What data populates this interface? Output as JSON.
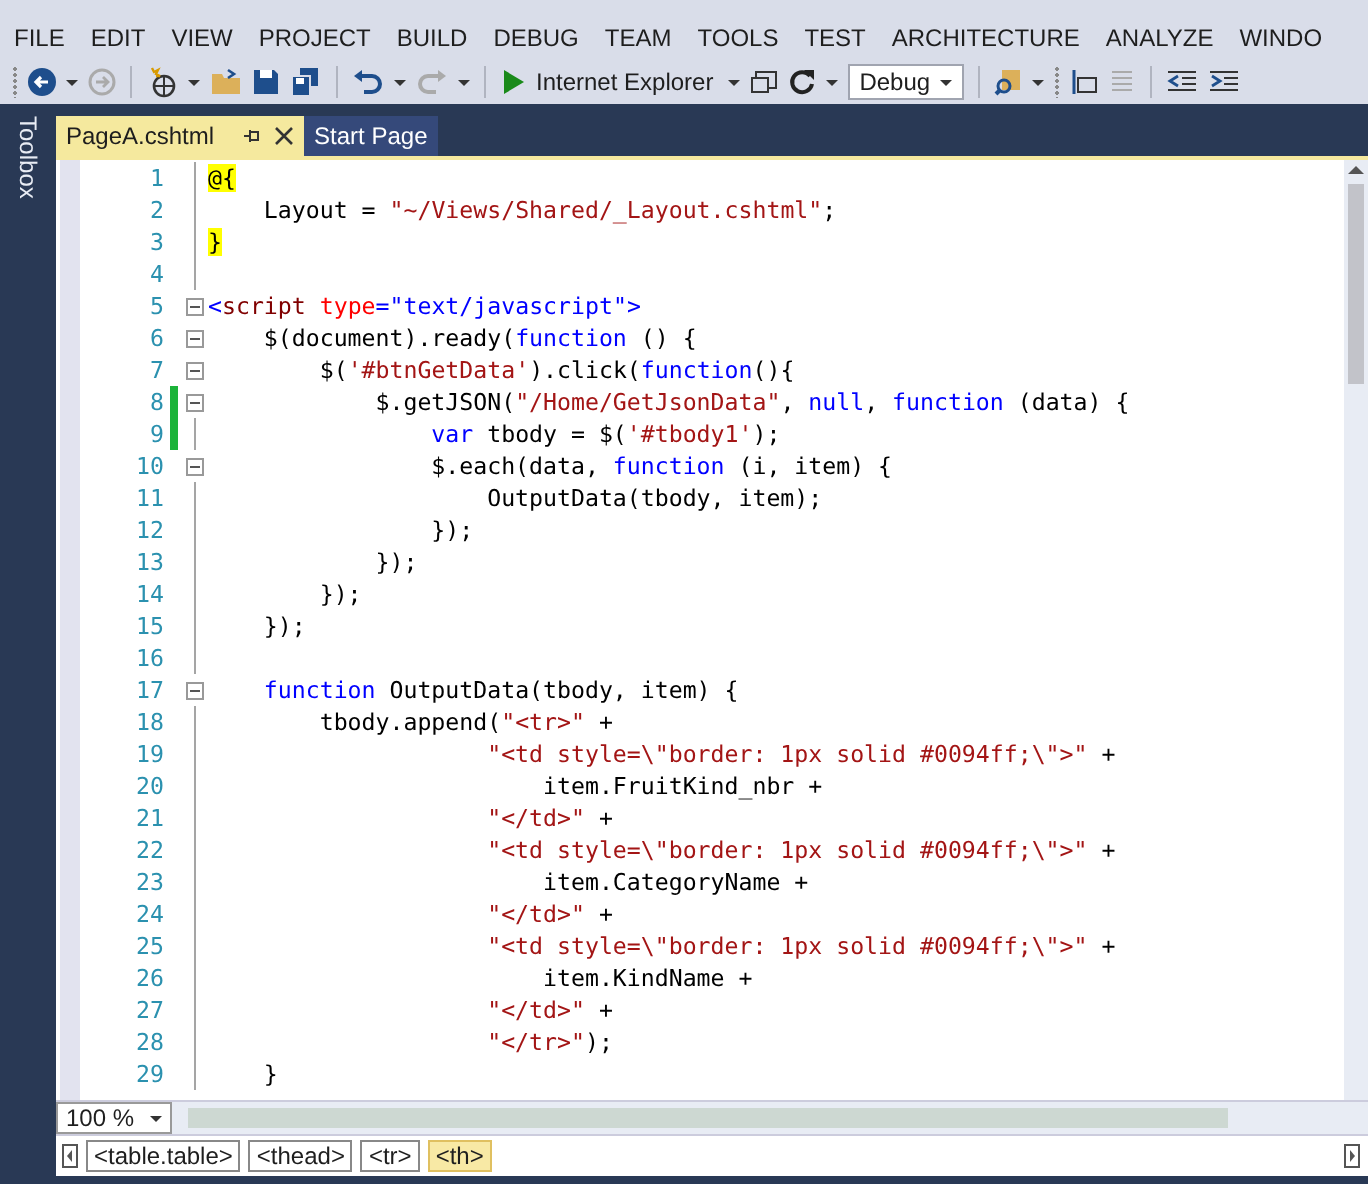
{
  "menu": [
    "FILE",
    "EDIT",
    "VIEW",
    "PROJECT",
    "BUILD",
    "DEBUG",
    "TEAM",
    "TOOLS",
    "TEST",
    "ARCHITECTURE",
    "ANALYZE",
    "WINDO"
  ],
  "toolbar": {
    "run_target": "Internet Explorer",
    "configuration": "Debug"
  },
  "toolbox": {
    "label": "Toolbox"
  },
  "tabs": [
    {
      "label": "PageA.cshtml",
      "selected": true
    },
    {
      "label": "Start Page",
      "selected": false
    }
  ],
  "lines": [
    {
      "number": "1",
      "fold": false,
      "changed": false,
      "tokens": [
        {
          "kind": "razor",
          "text": "@{"
        }
      ]
    },
    {
      "number": "2",
      "fold": false,
      "changed": false,
      "tokens": [
        {
          "kind": "plain",
          "text": "    Layout = "
        },
        {
          "kind": "string",
          "text": "\"~/Views/Shared/_Layout.cshtml\""
        },
        {
          "kind": "plain",
          "text": ";"
        }
      ]
    },
    {
      "number": "3",
      "fold": false,
      "changed": false,
      "tokens": [
        {
          "kind": "razor",
          "text": "}"
        }
      ]
    },
    {
      "number": "4",
      "fold": false,
      "changed": false
    },
    {
      "number": "5",
      "fold": true,
      "changed": false,
      "tokens": [
        {
          "kind": "punct",
          "text": "<"
        },
        {
          "kind": "tag",
          "text": "script"
        },
        {
          "kind": "attr",
          "text": " type"
        },
        {
          "kind": "punct",
          "text": "="
        },
        {
          "kind": "attrvalue",
          "text": "\"text/javascript\""
        },
        {
          "kind": "punct",
          "text": ">"
        }
      ]
    },
    {
      "number": "6",
      "fold": true,
      "changed": false,
      "tokens": [
        {
          "kind": "plain",
          "text": "    $(document).ready("
        },
        {
          "kind": "keyword",
          "text": "function"
        },
        {
          "kind": "plain",
          "text": " () {"
        }
      ]
    },
    {
      "number": "7",
      "fold": true,
      "changed": false,
      "tokens": [
        {
          "kind": "plain",
          "text": "        $("
        },
        {
          "kind": "string",
          "text": "'#btnGetData'"
        },
        {
          "kind": "plain",
          "text": ").click("
        },
        {
          "kind": "keyword",
          "text": "function"
        },
        {
          "kind": "plain",
          "text": "(){"
        }
      ]
    },
    {
      "number": "8",
      "fold": true,
      "changed": true,
      "tokens": [
        {
          "kind": "plain",
          "text": "            $.getJSON("
        },
        {
          "kind": "string",
          "text": "\"/Home/GetJsonData\""
        },
        {
          "kind": "plain",
          "text": ", "
        },
        {
          "kind": "keyword",
          "text": "null"
        },
        {
          "kind": "plain",
          "text": ", "
        },
        {
          "kind": "keyword",
          "text": "function"
        },
        {
          "kind": "plain",
          "text": " (data) {"
        }
      ]
    },
    {
      "number": "9",
      "fold": false,
      "changed": true,
      "tokens": [
        {
          "kind": "keyword",
          "text": "                var"
        },
        {
          "kind": "plain",
          "text": " tbody = $("
        },
        {
          "kind": "string",
          "text": "'#tbody1'"
        },
        {
          "kind": "plain",
          "text": ");"
        }
      ]
    },
    {
      "number": "10",
      "fold": true,
      "changed": false,
      "tokens": [
        {
          "kind": "plain",
          "text": "                $.each(data, "
        },
        {
          "kind": "keyword",
          "text": "function"
        },
        {
          "kind": "plain",
          "text": " (i, item) {"
        }
      ]
    },
    {
      "number": "11",
      "fold": false,
      "changed": false,
      "tokens": [
        {
          "kind": "plain",
          "text": "                    OutputData(tbody, item);"
        }
      ]
    },
    {
      "number": "12",
      "fold": false,
      "changed": false,
      "tokens": [
        {
          "kind": "plain",
          "text": "                });"
        }
      ]
    },
    {
      "number": "13",
      "fold": false,
      "changed": false,
      "tokens": [
        {
          "kind": "plain",
          "text": "            });"
        }
      ]
    },
    {
      "number": "14",
      "fold": false,
      "changed": false,
      "tokens": [
        {
          "kind": "plain",
          "text": "        });"
        }
      ]
    },
    {
      "number": "15",
      "fold": false,
      "changed": false,
      "tokens": [
        {
          "kind": "plain",
          "text": "    });"
        }
      ]
    },
    {
      "number": "16",
      "fold": false,
      "changed": false
    },
    {
      "number": "17",
      "fold": true,
      "changed": false,
      "tokens": [
        {
          "kind": "keyword",
          "text": "    function"
        },
        {
          "kind": "plain",
          "text": " OutputData(tbody, item) {"
        }
      ]
    },
    {
      "number": "18",
      "fold": false,
      "changed": false,
      "tokens": [
        {
          "kind": "plain",
          "text": "        tbody.append("
        },
        {
          "kind": "string",
          "text": "\"<tr>\""
        },
        {
          "kind": "plain",
          "text": " +"
        }
      ]
    },
    {
      "number": "19",
      "fold": false,
      "changed": false,
      "tokens": [
        {
          "kind": "string",
          "text": "                    \"<td style=\\\"border: 1px solid #0094ff;\\\">\""
        },
        {
          "kind": "plain",
          "text": " +"
        }
      ]
    },
    {
      "number": "20",
      "fold": false,
      "changed": false,
      "tokens": [
        {
          "kind": "plain",
          "text": "                        item.FruitKind_nbr +"
        }
      ]
    },
    {
      "number": "21",
      "fold": false,
      "changed": false,
      "tokens": [
        {
          "kind": "string",
          "text": "                    \"</td>\""
        },
        {
          "kind": "plain",
          "text": " +"
        }
      ]
    },
    {
      "number": "22",
      "fold": false,
      "changed": false,
      "tokens": [
        {
          "kind": "string",
          "text": "                    \"<td style=\\\"border: 1px solid #0094ff;\\\">\""
        },
        {
          "kind": "plain",
          "text": " +"
        }
      ]
    },
    {
      "number": "23",
      "fold": false,
      "changed": false,
      "tokens": [
        {
          "kind": "plain",
          "text": "                        item.CategoryName +"
        }
      ]
    },
    {
      "number": "24",
      "fold": false,
      "changed": false,
      "tokens": [
        {
          "kind": "string",
          "text": "                    \"</td>\""
        },
        {
          "kind": "plain",
          "text": " +"
        }
      ]
    },
    {
      "number": "25",
      "fold": false,
      "changed": false,
      "tokens": [
        {
          "kind": "string",
          "text": "                    \"<td style=\\\"border: 1px solid #0094ff;\\\">\""
        },
        {
          "kind": "plain",
          "text": " +"
        }
      ]
    },
    {
      "number": "26",
      "fold": false,
      "changed": false,
      "tokens": [
        {
          "kind": "plain",
          "text": "                        item.KindName +"
        }
      ]
    },
    {
      "number": "27",
      "fold": false,
      "changed": false,
      "tokens": [
        {
          "kind": "string",
          "text": "                    \"</td>\""
        },
        {
          "kind": "plain",
          "text": " +"
        }
      ]
    },
    {
      "number": "28",
      "fold": false,
      "changed": false,
      "tokens": [
        {
          "kind": "string",
          "text": "                    \"</tr>\""
        },
        {
          "kind": "plain",
          "text": ");"
        }
      ]
    },
    {
      "number": "29",
      "fold": false,
      "changed": false,
      "tokens": [
        {
          "kind": "plain",
          "text": "    }"
        }
      ]
    }
  ],
  "zoom": "100 %",
  "breadcrumb": [
    {
      "label": "<table.table>",
      "selected": false
    },
    {
      "label": "<thead>",
      "selected": false
    },
    {
      "label": "<tr>",
      "selected": false
    },
    {
      "label": "<th>",
      "selected": true
    }
  ]
}
